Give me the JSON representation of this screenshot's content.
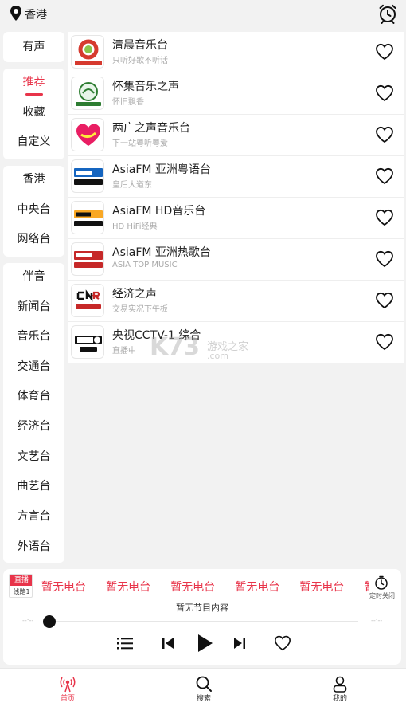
{
  "location": {
    "city": "香港",
    "icon": "location-pin-icon"
  },
  "alarm_icon": "alarm-clock-icon",
  "sidebar": {
    "group1": [
      "有声"
    ],
    "group2": [
      "推荐",
      "收藏",
      "自定义"
    ],
    "group2_active": "推荐",
    "group3": [
      "香港",
      "中央台",
      "网络台"
    ],
    "group4": [
      "伴音",
      "新闻台",
      "音乐台",
      "交通台",
      "体育台",
      "经济台",
      "文艺台",
      "曲艺台",
      "方言台",
      "外语台"
    ]
  },
  "stations": [
    {
      "name": "清晨音乐台",
      "sub": "只听好歌不听话",
      "logo_text": "清晨音乐台",
      "logo_color": "#d63a2f"
    },
    {
      "name": "怀集音乐之声",
      "sub": "怀旧飘香",
      "logo_text": "怀集音乐之声",
      "logo_color": "#2e7d32"
    },
    {
      "name": "两广之声音乐台",
      "sub": "下一站粤听粤爱",
      "logo_text": "两广之声",
      "logo_color": "#e91e63"
    },
    {
      "name": "AsiaFM 亚洲粤语台",
      "sub": "皇后大道东",
      "logo_text": "亚洲粤语台",
      "logo_color": "#1565c0"
    },
    {
      "name": "AsiaFM HD音乐台",
      "sub": "HD HiFi经典",
      "logo_text": "HD音乐台",
      "logo_color": "#f9a825"
    },
    {
      "name": "AsiaFM 亚洲热歌台",
      "sub": "ASIA TOP MUSIC",
      "logo_text": "亚洲热歌台",
      "logo_color": "#c62828"
    },
    {
      "name": "经济之声",
      "sub": "交易实况下午板",
      "logo_text": "经济之声",
      "logo_color": "#c62828"
    },
    {
      "name": "央视CCTV-1 综合",
      "sub": "直播中",
      "logo_text": "综合",
      "logo_color": "#111111"
    }
  ],
  "watermark": {
    "big": "K73",
    "cn": "游戏之家",
    "url": ".com"
  },
  "player": {
    "live_label": "直播",
    "line_label": "线路1",
    "marquee_text": "暂无电台",
    "timer_label": "定时关闭",
    "program": "暂无节目内容",
    "time_left": "--:--",
    "time_right": "--:--",
    "progress": 0
  },
  "bottom_nav": [
    {
      "label": "首页",
      "icon": "radio-icon",
      "active": true
    },
    {
      "label": "搜索",
      "icon": "search-icon",
      "active": false
    },
    {
      "label": "我的",
      "icon": "user-icon",
      "active": false
    }
  ],
  "colors": {
    "accent": "#e8344a",
    "background": "#f2f2f2"
  }
}
